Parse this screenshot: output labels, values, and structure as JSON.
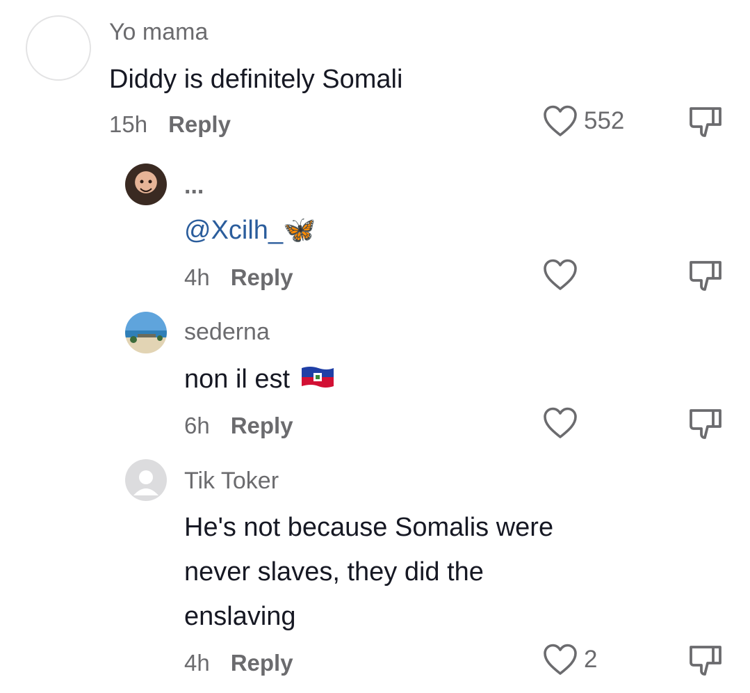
{
  "comments": [
    {
      "username": "Yo mama",
      "text": "Diddy is definitely Somali",
      "time": "15h",
      "reply_label": "Reply",
      "likes": "552"
    },
    {
      "username": "...",
      "text": "@Xcilh_",
      "text_emoji": "🦋",
      "time": "4h",
      "reply_label": "Reply",
      "likes": ""
    },
    {
      "username": "sederna",
      "text": "non il est",
      "text_emoji": "🇭🇹",
      "time": "6h",
      "reply_label": "Reply",
      "likes": ""
    },
    {
      "username": "Tik Toker",
      "text_lines": [
        "He's not because Somalis were",
        "never slaves, they did the",
        "enslaving"
      ],
      "time": "4h",
      "reply_label": "Reply",
      "likes": "2"
    }
  ],
  "colors": {
    "text": "#161823",
    "muted": "#6b6b6e",
    "mention": "#2b5d9c",
    "icon": "#6b6b6e"
  }
}
